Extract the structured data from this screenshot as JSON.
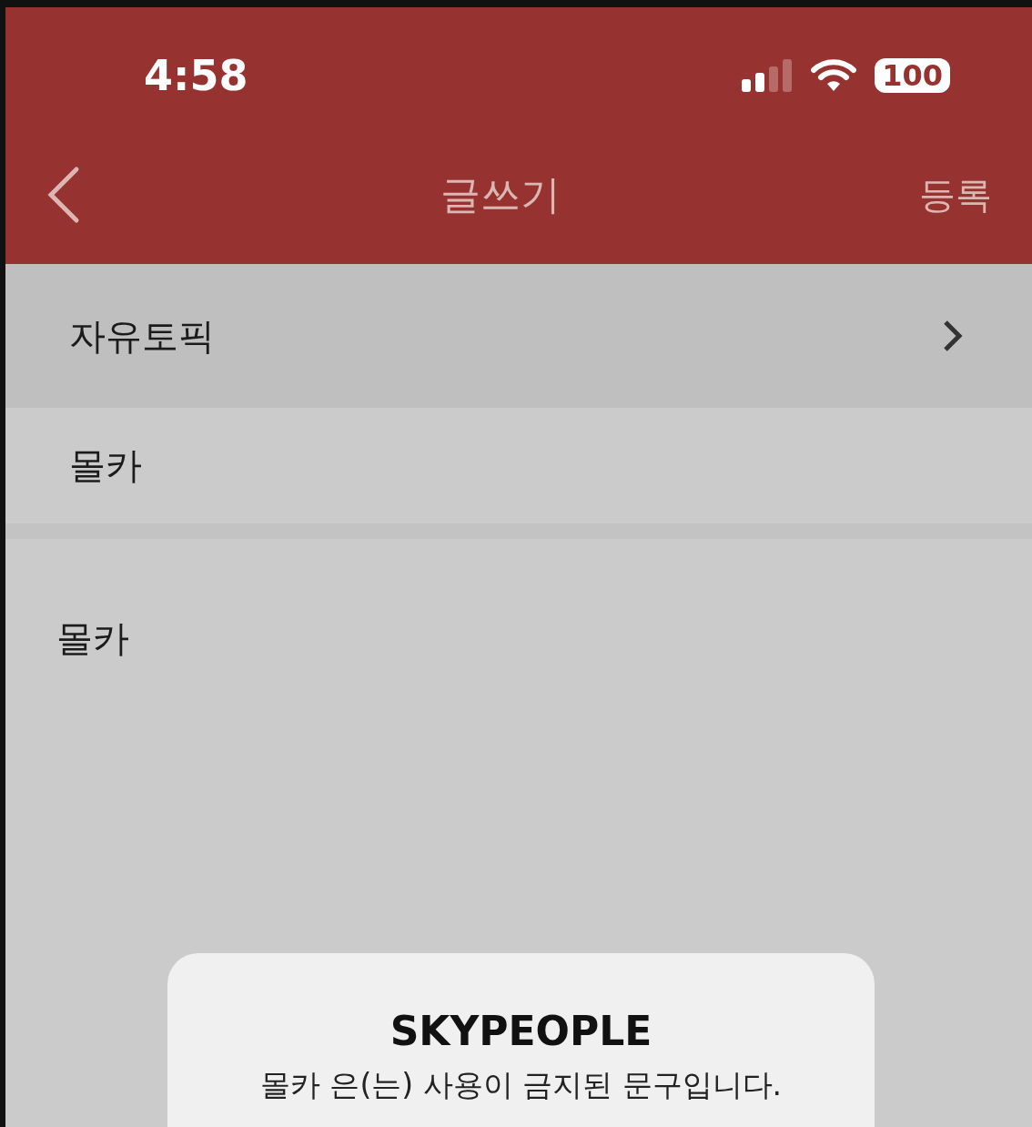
{
  "status_bar": {
    "time": "4:58",
    "battery": "100"
  },
  "nav_bar": {
    "title": "글쓰기",
    "action": "등록"
  },
  "category": {
    "label": "자유토픽"
  },
  "subject": {
    "value": "몰카"
  },
  "body": {
    "value": "몰카"
  },
  "alert": {
    "title": "SKYPEOPLE",
    "message": "몰카 은(는) 사용이 금지된 문구입니다."
  }
}
